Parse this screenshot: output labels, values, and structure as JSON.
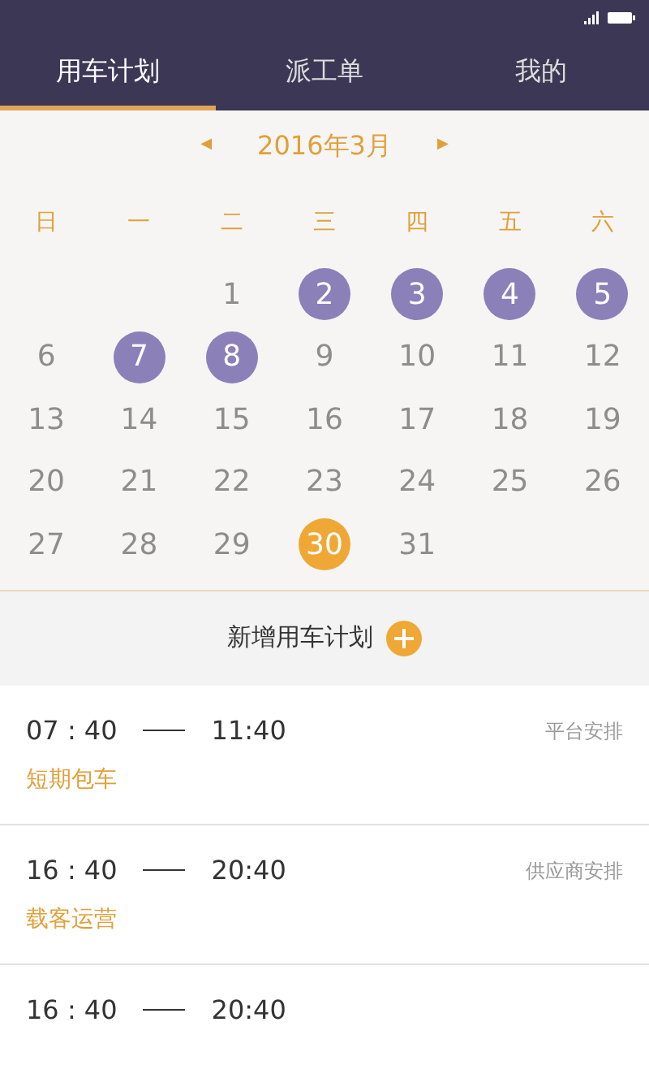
{
  "tabs": [
    {
      "label": "用车计划",
      "selected": true
    },
    {
      "label": "派工单",
      "selected": false
    },
    {
      "label": "我的",
      "selected": false
    }
  ],
  "calendar": {
    "prev": "◀",
    "title": "2016年3月",
    "next": "▶",
    "weekdays": [
      "日",
      "一",
      "二",
      "三",
      "四",
      "五",
      "六"
    ],
    "weeks": [
      [
        {
          "kind": "blank"
        },
        {
          "kind": "blank"
        },
        {
          "day": "1",
          "kind": "normal"
        },
        {
          "day": "2",
          "kind": "planned"
        },
        {
          "day": "3",
          "kind": "planned"
        },
        {
          "day": "4",
          "kind": "planned"
        },
        {
          "day": "5",
          "kind": "planned"
        }
      ],
      [
        {
          "day": "6",
          "kind": "normal"
        },
        {
          "day": "7",
          "kind": "planned"
        },
        {
          "day": "8",
          "kind": "planned"
        },
        {
          "day": "9",
          "kind": "normal"
        },
        {
          "day": "10",
          "kind": "normal"
        },
        {
          "day": "11",
          "kind": "normal"
        },
        {
          "day": "12",
          "kind": "normal"
        }
      ],
      [
        {
          "day": "13",
          "kind": "normal"
        },
        {
          "day": "14",
          "kind": "normal"
        },
        {
          "day": "15",
          "kind": "normal"
        },
        {
          "day": "16",
          "kind": "normal"
        },
        {
          "day": "17",
          "kind": "normal"
        },
        {
          "day": "18",
          "kind": "normal"
        },
        {
          "day": "19",
          "kind": "normal"
        }
      ],
      [
        {
          "day": "20",
          "kind": "normal"
        },
        {
          "day": "21",
          "kind": "normal"
        },
        {
          "day": "22",
          "kind": "normal"
        },
        {
          "day": "23",
          "kind": "normal"
        },
        {
          "day": "24",
          "kind": "normal"
        },
        {
          "day": "25",
          "kind": "normal"
        },
        {
          "day": "26",
          "kind": "normal"
        }
      ],
      [
        {
          "day": "27",
          "kind": "normal"
        },
        {
          "day": "28",
          "kind": "normal"
        },
        {
          "day": "29",
          "kind": "normal"
        },
        {
          "day": "30",
          "kind": "today"
        },
        {
          "day": "31",
          "kind": "normal"
        },
        {
          "kind": "blank"
        },
        {
          "kind": "blank"
        }
      ]
    ]
  },
  "add_plan": {
    "label": "新增用车计划"
  },
  "plans": [
    {
      "start": "07 : 40",
      "end": "11:40",
      "arranger": "平台安排",
      "category": "短期包车"
    },
    {
      "start": "16 : 40",
      "end": "20:40",
      "arranger": "供应商安排",
      "category": "载客运营"
    },
    {
      "start": "16 : 40",
      "end": "20:40"
    }
  ]
}
